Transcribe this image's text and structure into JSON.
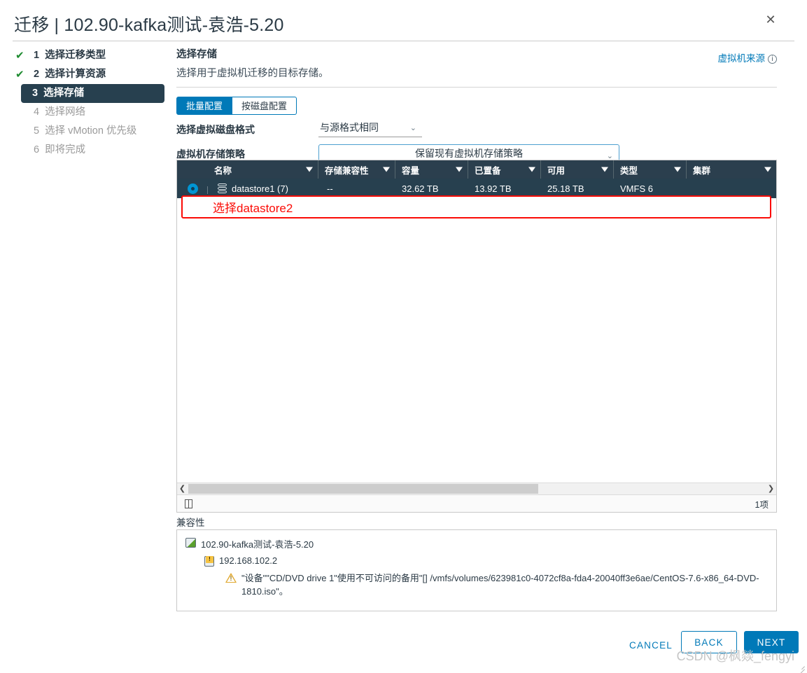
{
  "header": {
    "title": "迁移 | 102.90-kafka测试-袁浩-5.20",
    "close_label": "✕"
  },
  "steps": [
    {
      "num": "1",
      "label": "选择迁移类型",
      "state": "done",
      "tick": "✔"
    },
    {
      "num": "2",
      "label": "选择计算资源",
      "state": "done",
      "tick": "✔"
    },
    {
      "num": "3",
      "label": "选择存储",
      "state": "active",
      "tick": ""
    },
    {
      "num": "4",
      "label": "选择网络",
      "state": "todo",
      "tick": ""
    },
    {
      "num": "5",
      "label": "选择 vMotion 优先级",
      "state": "todo",
      "tick": ""
    },
    {
      "num": "6",
      "label": "即将完成",
      "state": "todo",
      "tick": ""
    }
  ],
  "pane": {
    "title": "选择存储",
    "subtitle": "选择用于虚拟机迁移的目标存储。",
    "source_link": "虚拟机来源",
    "source_info_icon": "info-icon"
  },
  "tabs": [
    {
      "label": "批量配置",
      "selected": true
    },
    {
      "label": "按磁盘配置",
      "selected": false
    }
  ],
  "form": {
    "disk_format_label": "选择虚拟磁盘格式",
    "disk_format_value": "与源格式相同",
    "storage_policy_label": "虚拟机存储策略",
    "storage_policy_value": "保留现有虚拟机存储策略",
    "caret_icon": "chevron-down-icon"
  },
  "table": {
    "columns": [
      {
        "key": "select",
        "label": ""
      },
      {
        "key": "name",
        "label": "名称"
      },
      {
        "key": "compat",
        "label": "存储兼容性"
      },
      {
        "key": "capacity",
        "label": "容量"
      },
      {
        "key": "provisioned",
        "label": "已置备"
      },
      {
        "key": "free",
        "label": "可用"
      },
      {
        "key": "type",
        "label": "类型"
      },
      {
        "key": "cluster",
        "label": "集群"
      }
    ],
    "rows": [
      {
        "selected": true,
        "name": "datastore1 (7)",
        "compat": "--",
        "capacity": "32.62 TB",
        "provisioned": "13.92 TB",
        "free": "25.18 TB",
        "type": "VMFS 6",
        "cluster": ""
      }
    ],
    "annotation": "选择datastore2",
    "annotation_color": "#fb0b06",
    "footer_count": "1项",
    "scroll_left_icon": "chevron-left-icon",
    "scroll_right_icon": "chevron-right-icon",
    "column_picker_icon": "columns-icon"
  },
  "compatibility": {
    "label": "兼容性",
    "vm_name": "102.90-kafka测试-袁浩-5.20",
    "host_ip": "192.168.102.2",
    "warning": "\"设备\"\"CD/DVD drive 1\"使用不可访问的备用\"[] /vmfs/volumes/623981c0-4072cf8a-fda4-20040ff3e6ae/CentOS-7.6-x86_64-DVD-1810.iso\"。",
    "warning_icon": "warning-triangle-icon",
    "vm_icon": "virtual-machine-icon",
    "host_icon": "host-warning-icon"
  },
  "footer": {
    "cancel": "CANCEL",
    "back": "BACK",
    "next": "NEXT"
  },
  "watermark": "CSDN @枫燚_fengyi",
  "colors": {
    "accent": "#0079b8",
    "header_dark": "#2b3f4e",
    "row_dark": "#27404f",
    "radio": "#0095d3",
    "annotation_red": "#fb0b06",
    "check_green": "#1d8b2f"
  }
}
